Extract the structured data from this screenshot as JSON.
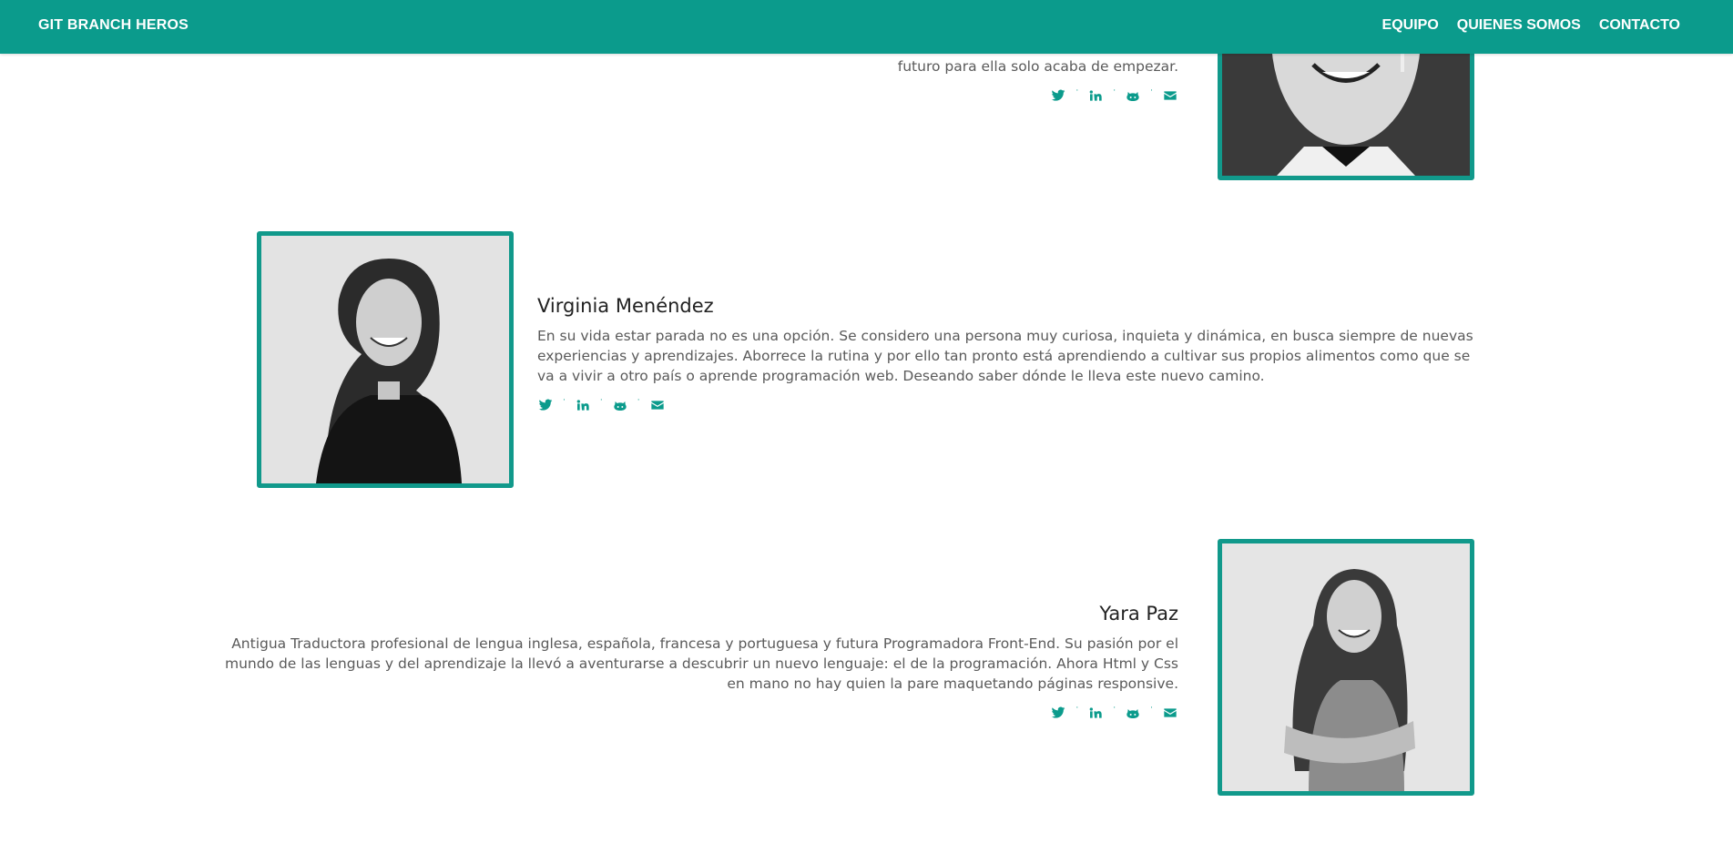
{
  "navbar": {
    "brand": "GIT BRANCH HEROS",
    "links": [
      "EQUIPO",
      "QUIENES SOMOS",
      "CONTACTO"
    ]
  },
  "members": [
    {
      "name": "",
      "bio_partial": "futuro para ella solo acaba de empezar."
    },
    {
      "name": "Virginia Menéndez",
      "bio": "En su vida estar parada no es una opción. Se considero una persona muy curiosa, inquieta y dinámica, en busca siempre de nuevas experiencias y aprendizajes. Aborrece la rutina y por ello tan pronto está aprendiendo a cultivar sus propios alimentos como que se va a vivir a otro país o aprende programación web. Deseando saber dónde le lleva este nuevo camino."
    },
    {
      "name": "Yara Paz",
      "bio": "Antigua Traductora profesional de lengua inglesa, española, francesa y portuguesa y futura Programadora Front-End. Su pasión por el mundo de las lenguas y del aprendizaje la llevó a aventurarse a descubrir un nuevo lenguaje: el de la programación. Ahora Html y Css en mano no hay quien la pare maquetando páginas responsive."
    }
  ],
  "social_icons": [
    "twitter-icon",
    "linkedin-icon",
    "github-icon",
    "envelope-icon"
  ],
  "colors": {
    "accent": "#0b9b8c",
    "photo_border": "#11998b"
  }
}
